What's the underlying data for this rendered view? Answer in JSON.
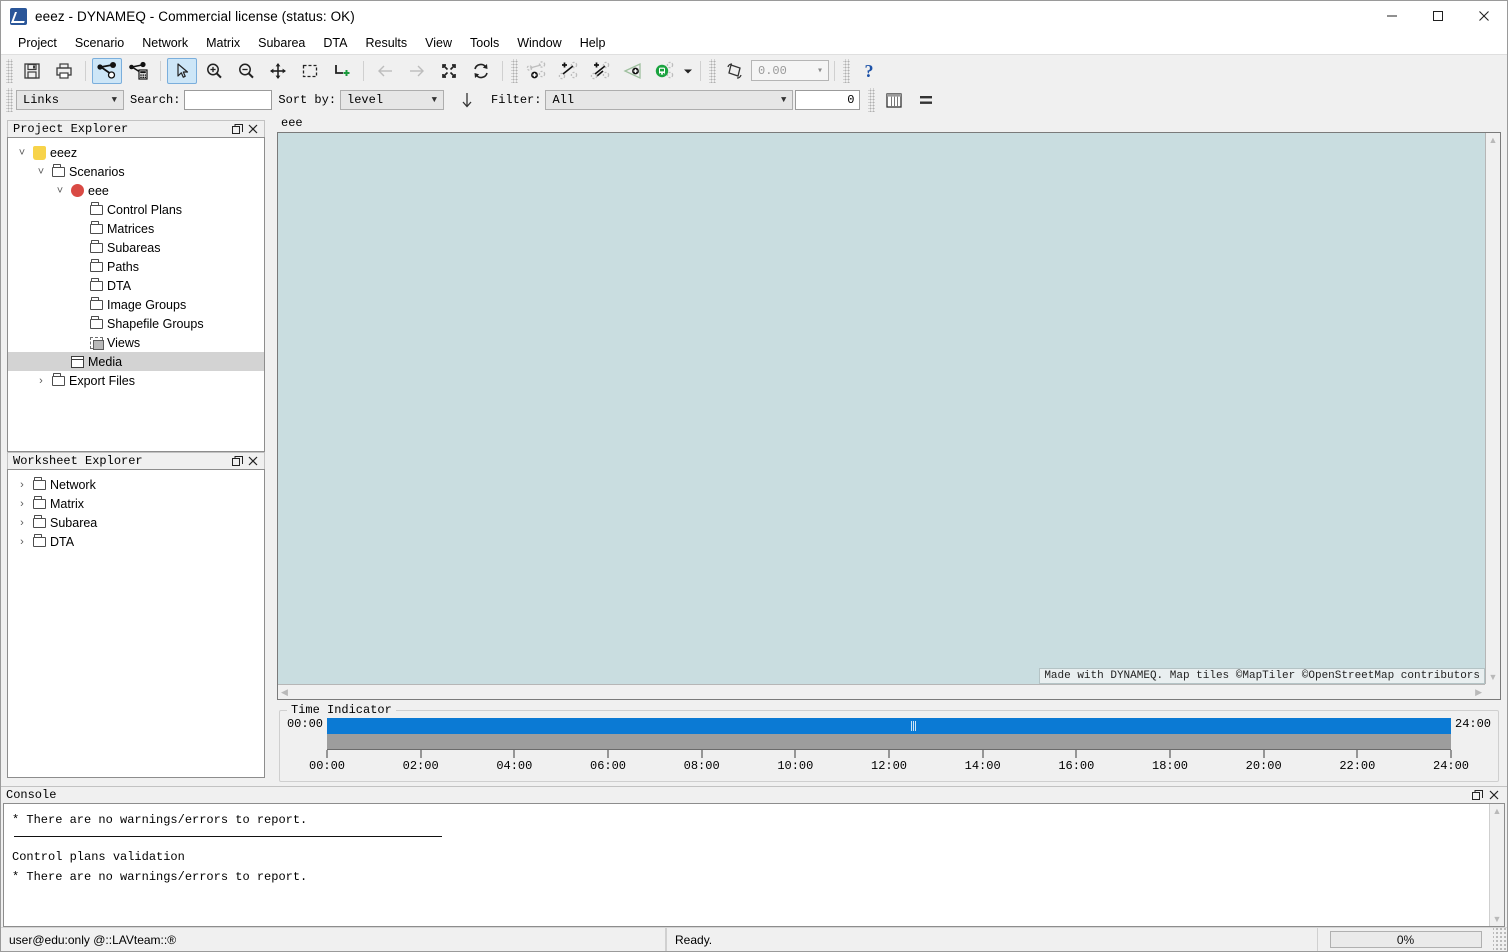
{
  "window": {
    "title": "eeez - DYNAMEQ - Commercial license (status: OK)",
    "app_icon": "dynameq-logo-icon",
    "minimize": "—",
    "maximize": "□",
    "close": "✕"
  },
  "menu": {
    "items": [
      {
        "label": "Project"
      },
      {
        "label": "Scenario"
      },
      {
        "label": "Network"
      },
      {
        "label": "Matrix"
      },
      {
        "label": "Subarea"
      },
      {
        "label": "DTA"
      },
      {
        "label": "Results"
      },
      {
        "label": "View"
      },
      {
        "label": "Tools"
      },
      {
        "label": "Window"
      },
      {
        "label": "Help"
      }
    ]
  },
  "toolbar": {
    "buttons": [
      {
        "name": "save-icon"
      },
      {
        "name": "print-icon"
      },
      {
        "name": "network-links-icon"
      },
      {
        "name": "network-calculator-icon"
      },
      {
        "name": "select-pointer-icon"
      },
      {
        "name": "zoom-in-icon"
      },
      {
        "name": "zoom-out-icon"
      },
      {
        "name": "pan-icon"
      },
      {
        "name": "rubber-band-select-icon"
      },
      {
        "name": "add-polyline-icon"
      },
      {
        "name": "back-arrow-icon"
      },
      {
        "name": "forward-arrow-icon"
      },
      {
        "name": "zoom-to-fit-icon"
      },
      {
        "name": "refresh-icon"
      },
      {
        "name": "add-node-icon"
      },
      {
        "name": "add-link-icon"
      },
      {
        "name": "edit-link-icon"
      },
      {
        "name": "add-centroid-icon"
      },
      {
        "name": "add-transit-icon"
      },
      {
        "name": "transit-dropdown-icon"
      },
      {
        "name": "rotate-icon"
      },
      {
        "name": "help-icon"
      }
    ],
    "rotation_value": "0.00"
  },
  "filterbar": {
    "object_type": "Links",
    "search_label": "Search:",
    "search_value": "",
    "search_placeholder": "",
    "sort_label": "Sort by:",
    "sort_value": "level",
    "sort_direction_icon": "arrow-down-icon",
    "filter_label": "Filter:",
    "filter_value": "All",
    "filter_count": "0",
    "table_view_icon": "table-view-icon",
    "list_view_icon": "list-view-icon"
  },
  "project_explorer": {
    "title": "Project Explorer",
    "float_btn": "❐",
    "close_btn": "✕",
    "tree": [
      {
        "label": "eeez",
        "indent": 0,
        "expander": "expanded",
        "icon": "project-icon",
        "selected": false
      },
      {
        "label": "Scenarios",
        "indent": 1,
        "expander": "expanded",
        "icon": "folder-icon",
        "selected": false
      },
      {
        "label": "eee",
        "indent": 2,
        "expander": "expanded",
        "icon": "scenario-dot-icon",
        "selected": false
      },
      {
        "label": "Control Plans",
        "indent": 3,
        "expander": "none",
        "icon": "folder-icon",
        "selected": false
      },
      {
        "label": "Matrices",
        "indent": 3,
        "expander": "none",
        "icon": "folder-icon",
        "selected": false
      },
      {
        "label": "Subareas",
        "indent": 3,
        "expander": "none",
        "icon": "folder-icon",
        "selected": false
      },
      {
        "label": "Paths",
        "indent": 3,
        "expander": "none",
        "icon": "folder-icon",
        "selected": false
      },
      {
        "label": "DTA",
        "indent": 3,
        "expander": "none",
        "icon": "folder-icon",
        "selected": false
      },
      {
        "label": "Image Groups",
        "indent": 3,
        "expander": "none",
        "icon": "folder-icon",
        "selected": false
      },
      {
        "label": "Shapefile Groups",
        "indent": 3,
        "expander": "none",
        "icon": "folder-icon",
        "selected": false
      },
      {
        "label": "Views",
        "indent": 3,
        "expander": "none",
        "icon": "views-icon",
        "selected": false
      },
      {
        "label": "Media",
        "indent": 2,
        "expander": "none",
        "icon": "media-icon",
        "selected": true
      },
      {
        "label": "Export Files",
        "indent": 1,
        "expander": "collapsed",
        "icon": "folder-icon",
        "selected": false
      }
    ]
  },
  "worksheet_explorer": {
    "title": "Worksheet Explorer",
    "float_btn": "❐",
    "close_btn": "✕",
    "tree": [
      {
        "label": "Network",
        "indent": 0,
        "expander": "collapsed",
        "icon": "folder-icon",
        "selected": false
      },
      {
        "label": "Matrix",
        "indent": 0,
        "expander": "collapsed",
        "icon": "folder-icon",
        "selected": false
      },
      {
        "label": "Subarea",
        "indent": 0,
        "expander": "collapsed",
        "icon": "folder-icon",
        "selected": false
      },
      {
        "label": "DTA",
        "indent": 0,
        "expander": "collapsed",
        "icon": "folder-icon",
        "selected": false
      }
    ]
  },
  "map": {
    "tab_label": "eee",
    "canvas_color": "#c9dde0",
    "attribution": "Made with DYNAMEQ. Map tiles ©MapTiler ©OpenStreetMap contributors",
    "scroll_up": "▲",
    "scroll_down": "▼",
    "scroll_left": "◀",
    "scroll_right": "▶"
  },
  "time_indicator": {
    "legend": "Time Indicator",
    "start_label": "00:00",
    "end_label": "24:00",
    "handle_position_pct": 52.0,
    "bar_color": "#0b7ad4",
    "ticks": [
      "00:00",
      "02:00",
      "04:00",
      "06:00",
      "08:00",
      "10:00",
      "12:00",
      "14:00",
      "16:00",
      "18:00",
      "20:00",
      "22:00",
      "24:00"
    ]
  },
  "console": {
    "title": "Console",
    "float_btn": "❐",
    "close_btn": "✕",
    "line1": "* There are no warnings/errors to report.",
    "line2": "Control plans validation",
    "line3": "* There are no warnings/errors to report."
  },
  "statusbar": {
    "user": "user@edu:only @::LAVteam::®",
    "ready": "Ready.",
    "progress": "0%"
  }
}
